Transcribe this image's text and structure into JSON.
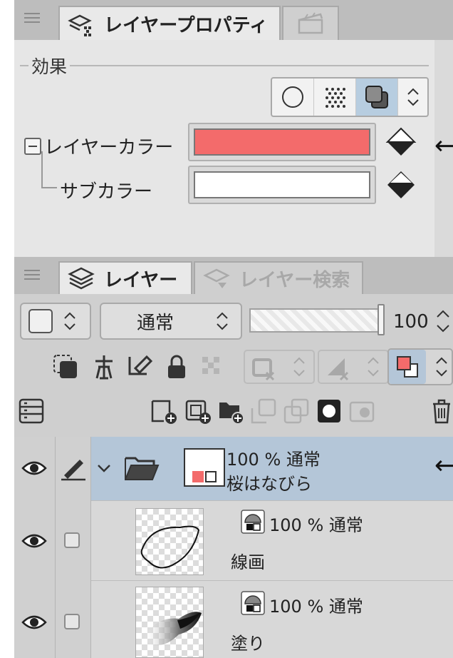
{
  "property_panel": {
    "tab_label": "レイヤープロパティ",
    "section_title": "効果",
    "layer_color_label": "レイヤーカラー",
    "layer_color": "#f36b6b",
    "sub_color_label": "サブカラー",
    "sub_color": "#ffffff"
  },
  "layer_panel": {
    "tab_label": "レイヤー",
    "search_tab_label": "レイヤー検索",
    "blend_mode": "通常",
    "opacity": "100",
    "layers": [
      {
        "blend": "100 % 通常",
        "name": "桜はなびら",
        "selected": true
      },
      {
        "blend": "100 % 通常",
        "name": "線画",
        "selected": false
      },
      {
        "blend": "100 % 通常",
        "name": "塗り",
        "selected": false
      }
    ]
  },
  "annotation_arrow": "←",
  "colors": {
    "selected_row": "#b4c6d8",
    "accent": "#f36b6b"
  }
}
